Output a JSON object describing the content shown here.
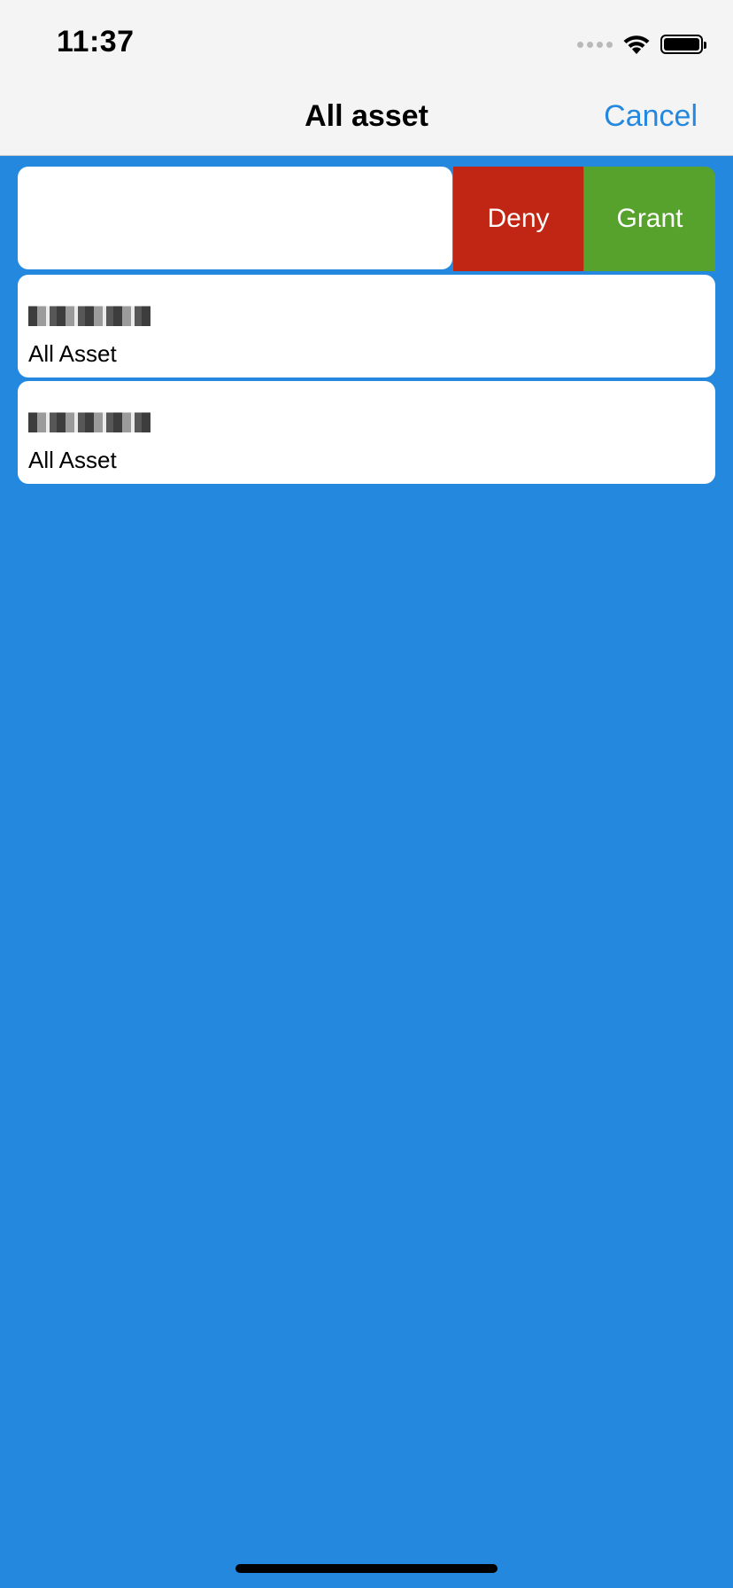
{
  "status_bar": {
    "time": "11:37",
    "icons": [
      "signal-icon",
      "wifi-icon",
      "battery-icon"
    ]
  },
  "nav": {
    "title": "All asset",
    "cancel_label": "Cancel"
  },
  "swipe_actions": {
    "deny_label": "Deny",
    "grant_label": "Grant",
    "deny_color": "#C12614",
    "grant_color": "#57A22C"
  },
  "list": {
    "items": [
      {
        "name": "",
        "subtitle": "All Asset"
      },
      {
        "name": "",
        "subtitle": "All Asset"
      }
    ]
  },
  "colors": {
    "background": "#2588DF",
    "accent": "#2588DF",
    "bar": "#F4F4F4"
  }
}
